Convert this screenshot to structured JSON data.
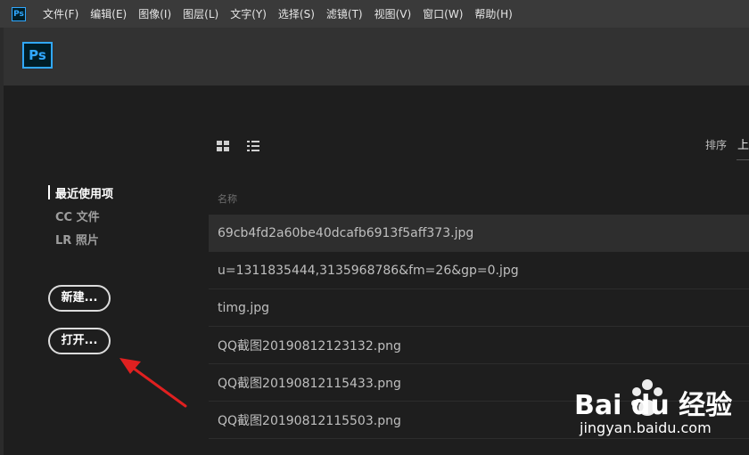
{
  "app": {
    "menu_icon": "Ps",
    "menu": [
      "文件(F)",
      "编辑(E)",
      "图像(I)",
      "图层(L)",
      "文字(Y)",
      "选择(S)",
      "滤镜(T)",
      "视图(V)",
      "窗口(W)",
      "帮助(H)"
    ],
    "logo": "Ps"
  },
  "sidebar": {
    "items": [
      {
        "label": "最近使用项",
        "active": true
      },
      {
        "label": "CC 文件",
        "active": false
      },
      {
        "label": "LR 照片",
        "active": false
      }
    ],
    "new_button": "新建...",
    "open_button": "打开..."
  },
  "toolbar": {
    "sort_label": "排序",
    "sort_value": "上"
  },
  "file_list": {
    "column_name": "名称",
    "files": [
      "69cb4fd2a60be40dcafb6913f5aff373.jpg",
      "u=1311835444,3135968786&fm=26&gp=0.jpg",
      "timg.jpg",
      "QQ截图20190812123132.png",
      "QQ截图20190812115433.png",
      "QQ截图20190812115503.png"
    ]
  },
  "watermark": {
    "brand": "Bai du 经验",
    "url": "jingyan.baidu.com"
  },
  "colors": {
    "accent": "#31a8ff",
    "annotation_arrow": "#e02020"
  }
}
